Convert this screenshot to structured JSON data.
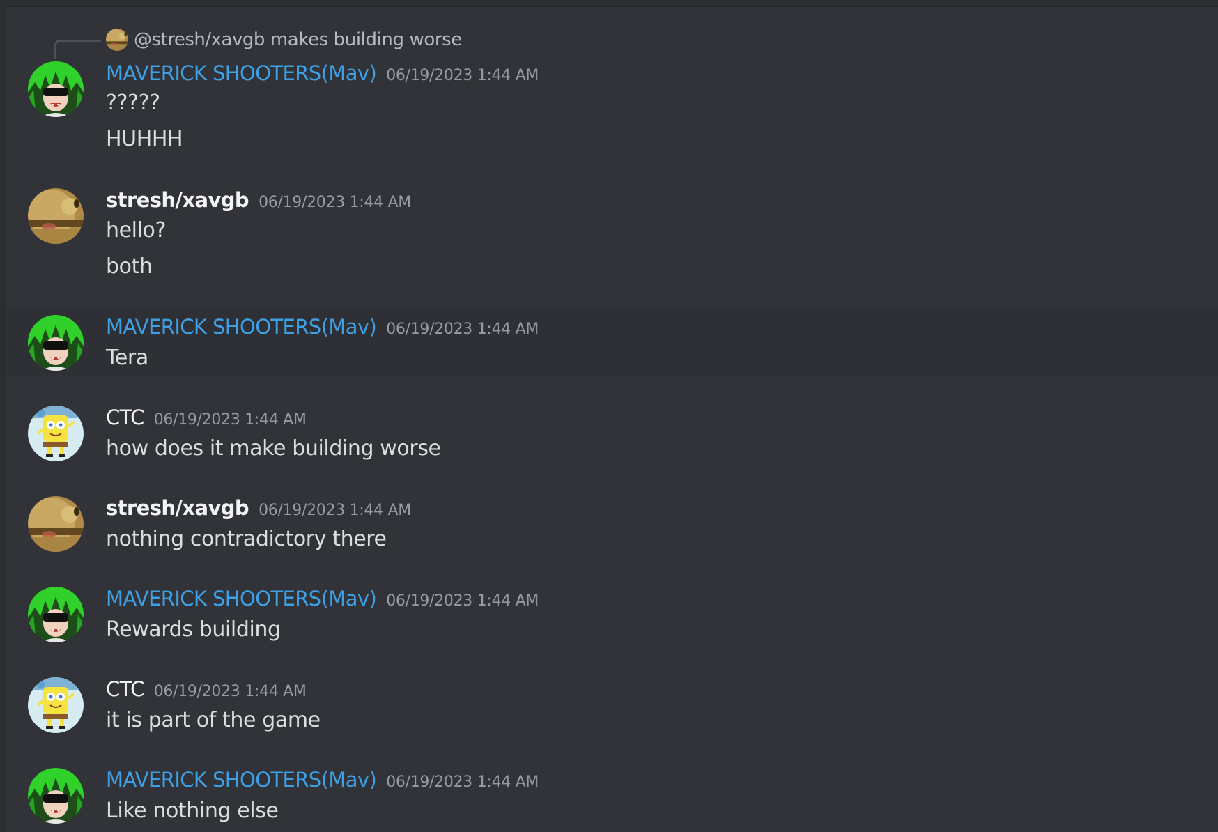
{
  "reply": {
    "mention": "@stresh/xavgb",
    "text": "makes building worse"
  },
  "messages": [
    {
      "author": "MAVERICK SHOOTERS(Mav)",
      "time": "06/19/2023 1:44 AM",
      "lines": [
        "?????",
        "HUHHH"
      ]
    },
    {
      "author": "stresh/xavgb",
      "time": "06/19/2023 1:44 AM",
      "lines": [
        "hello?",
        "both"
      ]
    },
    {
      "author": "MAVERICK SHOOTERS(Mav)",
      "time": "06/19/2023 1:44 AM",
      "lines": [
        "Tera"
      ]
    },
    {
      "author": "CTC",
      "time": "06/19/2023 1:44 AM",
      "lines": [
        "how does it make building worse"
      ]
    },
    {
      "author": "stresh/xavgb",
      "time": "06/19/2023 1:44 AM",
      "lines": [
        "nothing contradictory there"
      ]
    },
    {
      "author": "MAVERICK SHOOTERS(Mav)",
      "time": "06/19/2023 1:44 AM",
      "lines": [
        "Rewards building"
      ]
    },
    {
      "author": "CTC",
      "time": "06/19/2023 1:44 AM",
      "lines": [
        "it is part of the game"
      ]
    },
    {
      "author": "MAVERICK SHOOTERS(Mav)",
      "time": "06/19/2023 1:44 AM",
      "lines": [
        "Like nothing else"
      ]
    }
  ],
  "colors": {
    "background": "#313338",
    "mav_name": "#3ea1e6",
    "text": "#dbdee1",
    "timestamp": "#949ba4"
  },
  "icons": {
    "mav": "mav-avatar-icon",
    "stresh": "stresh-avatar-icon",
    "ctc": "ctc-avatar-icon"
  }
}
